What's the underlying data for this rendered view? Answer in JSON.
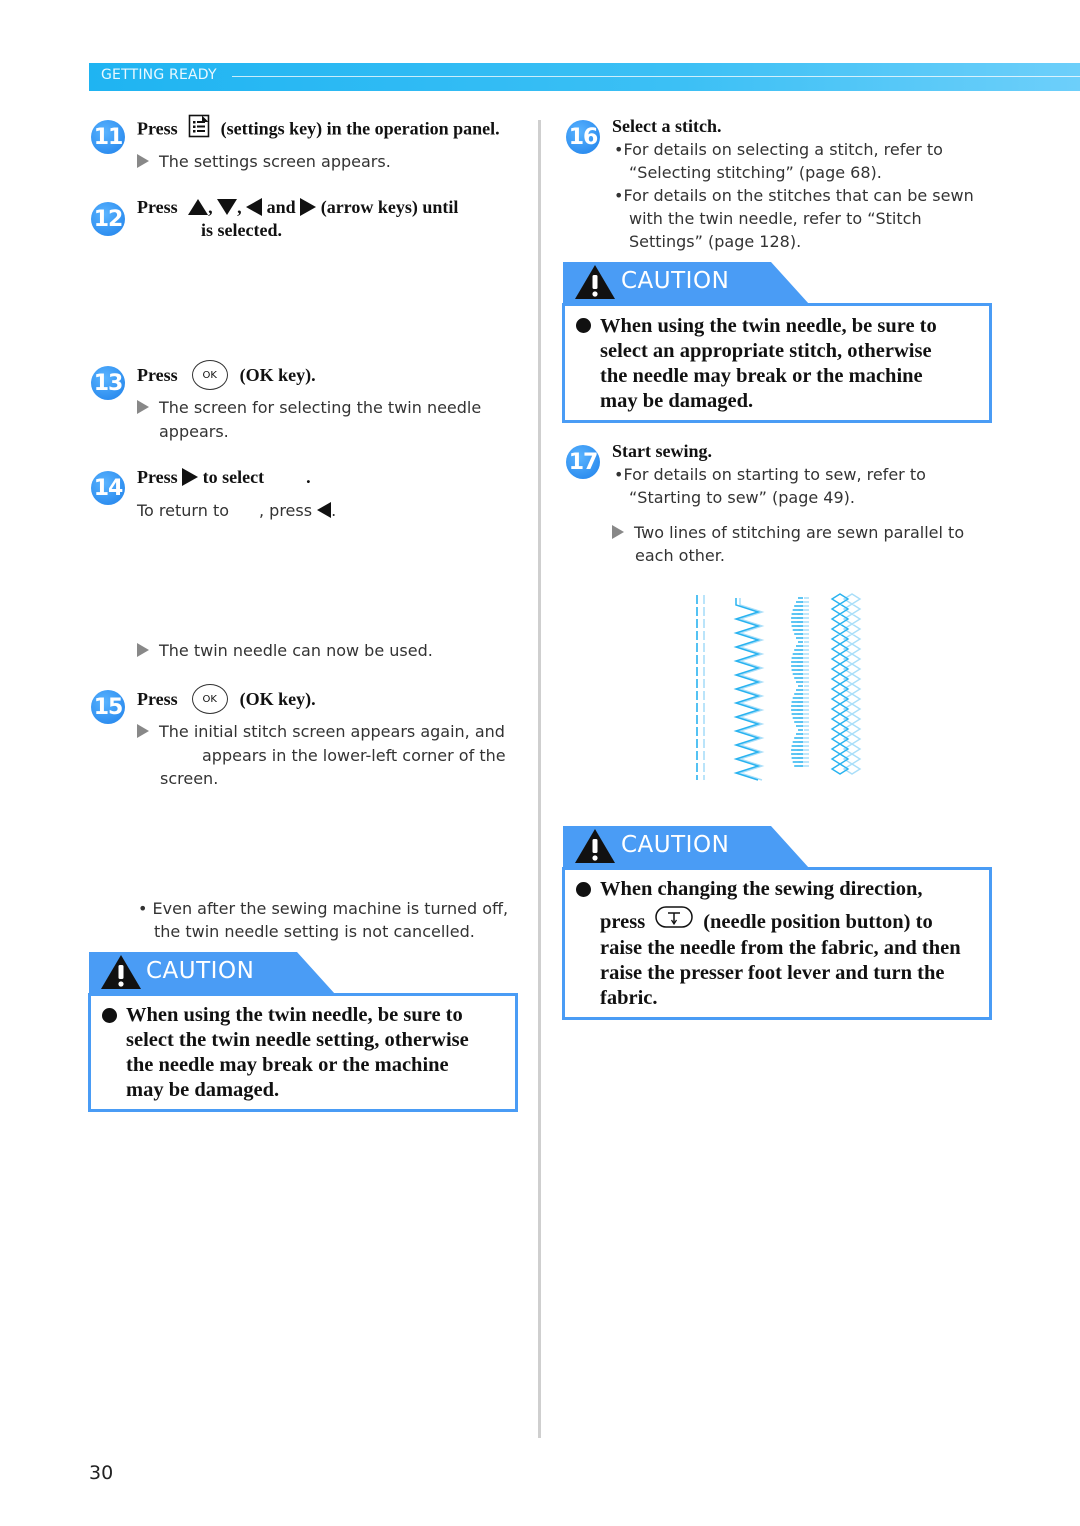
{
  "header": {
    "section_title": "GETTING READY"
  },
  "left_column": {
    "steps": [
      {
        "number": "11",
        "head_prefix": "Press",
        "head_icon": "settings-key-icon",
        "head_suffix": "(settings key) in the operation panel.",
        "result": "The settings screen appears."
      },
      {
        "number": "12",
        "head_prefix": "Press",
        "sep1": ",",
        "sep2": ",",
        "and": "and",
        "head_suffix": "(arrow keys) until",
        "line2": "is selected."
      },
      {
        "number": "13",
        "head_prefix": "Press",
        "key_label": "OK",
        "head_suffix": "(OK key).",
        "result": "The screen for selecting the twin needle appears."
      },
      {
        "number": "14",
        "head_prefix": "Press",
        "head_suffix": "to select",
        "head_end": ".",
        "note_prefix": "To return to",
        "note_mid": ", press",
        "note_end": ".",
        "result": "The twin needle can now be used."
      },
      {
        "number": "15",
        "head_prefix": "Press",
        "key_label": "OK",
        "head_suffix": "(OK key).",
        "result_line1": "The initial stitch screen appears again, and",
        "result_line2": "appears in the lower-left corner of the",
        "result_line3": "screen."
      }
    ],
    "note_bullet": "Even after the sewing machine is turned off, the twin needle setting is not cancelled.",
    "note_line1": "Even after the sewing machine is turned off,",
    "note_line2": "the twin needle setting is not cancelled.",
    "caution": {
      "title": "CAUTION",
      "lines": [
        "When using the twin needle, be sure to",
        "select the twin needle setting, otherwise",
        "the needle may break or the machine",
        "may be damaged."
      ]
    }
  },
  "right_column": {
    "step16": {
      "number": "16",
      "head": "Select a stitch.",
      "bullets": [
        [
          "For details on selecting a stitch, refer to",
          "“Selecting stitching” (page 68)."
        ],
        [
          "For details on the stitches that can be sewn",
          "with the twin needle, refer to “Stitch",
          "Settings” (page 128)."
        ]
      ]
    },
    "caution1": {
      "title": "CAUTION",
      "lines": [
        "When using the twin needle, be sure to",
        "select an appropriate stitch, otherwise",
        "the needle may break or the machine",
        "may be damaged."
      ]
    },
    "step17": {
      "number": "17",
      "head": "Start sewing.",
      "bullet": [
        "For details on starting to sew, refer to",
        "“Starting to sew” (page 49)."
      ],
      "result": [
        "Two lines of stitching are sewn parallel to",
        "each other."
      ]
    },
    "stitch_illustration": {
      "samples": [
        "straight-stitch",
        "zigzag-stitch",
        "scallop-satin-stitch",
        "diamond-cross-stitch"
      ],
      "colors": {
        "primary": "#29b3f0",
        "secondary": "#a9def9"
      }
    },
    "caution2": {
      "title": "CAUTION",
      "line1": "When changing the sewing direction,",
      "press_word": "press",
      "press_suffix": "(needle position button) to",
      "lines": [
        "raise the needle from the fabric, and then",
        "raise the presser foot lever and turn the",
        "fabric."
      ]
    }
  },
  "footer": {
    "page_number": "30"
  },
  "colors": {
    "header_blue": "#1fb4f2",
    "caution_blue": "#4a9cf5",
    "step_badge_blue": "#2f8ff0"
  }
}
